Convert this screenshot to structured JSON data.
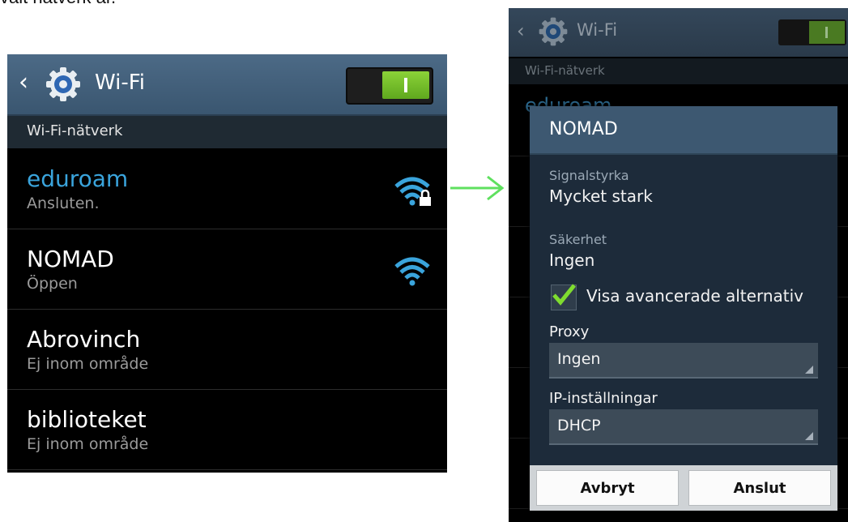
{
  "caption": "valt nätverk är.",
  "left": {
    "header": {
      "back_glyph": "‹",
      "title": "Wi-Fi",
      "toggle_state": "on"
    },
    "section_title": "Wi-Fi-nätverk",
    "networks": [
      {
        "name": "eduroam",
        "status": "Ansluten.",
        "icon": "wifi-lock-icon",
        "connected": true
      },
      {
        "name": "NOMAD",
        "status": "Öppen",
        "icon": "wifi-icon",
        "connected": false
      },
      {
        "name": "Abrovinch",
        "status": "Ej inom område",
        "icon": "",
        "connected": false
      },
      {
        "name": "biblioteket",
        "status": "Ej inom område",
        "icon": "",
        "connected": false
      }
    ]
  },
  "right": {
    "header": {
      "back_glyph": "‹",
      "title": "Wi-Fi",
      "toggle_state": "on"
    },
    "section_title": "Wi-Fi-nätverk",
    "background_row": {
      "name": "eduroam"
    },
    "dialog": {
      "title": "NOMAD",
      "signal_label": "Signalstyrka",
      "signal_value": "Mycket stark",
      "security_label": "Säkerhet",
      "security_value": "Ingen",
      "advanced_label": "Visa avancerade alternativ",
      "advanced_checked": true,
      "proxy_label": "Proxy",
      "proxy_value": "Ingen",
      "ip_label": "IP-inställningar",
      "ip_value": "DHCP",
      "cancel_label": "Avbryt",
      "connect_label": "Anslut"
    }
  },
  "colors": {
    "accent_blue": "#3aa4dc",
    "toggle_green": "#6fbf26",
    "arrow_green": "#5fe05f"
  }
}
